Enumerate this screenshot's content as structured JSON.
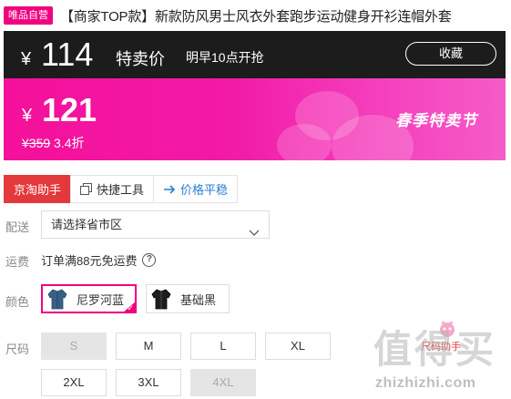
{
  "product": {
    "badge": "唯品自营",
    "title": "【商家TOP款】新款防风男士风衣外套跑步运动健身开衫连帽外套"
  },
  "price_banner": {
    "currency": "¥",
    "special_price": "114",
    "special_label": "特卖价",
    "start_time": "明早10点开抢",
    "favorite_label": "收藏",
    "current_price": "121",
    "original_price": "¥359",
    "discount": "3.4折",
    "promo": "春季特卖节",
    "colors": {
      "dark": "#1c1c1c",
      "pink": "#f4109a"
    }
  },
  "tools": {
    "tabs": [
      {
        "label": "京淘助手",
        "icon": ""
      },
      {
        "label": "快捷工具",
        "icon": "copy-icon"
      },
      {
        "label": "价格平稳",
        "icon": "arrow-right-icon"
      }
    ],
    "active_color": "#e4393c"
  },
  "delivery": {
    "label": "配送",
    "select_value": "请选择省市区"
  },
  "freight": {
    "label": "运费",
    "text": "订单满88元免运费",
    "help_icon": "question-circle-icon"
  },
  "color": {
    "label": "颜色",
    "options": [
      {
        "name": "尼罗河蓝",
        "selected": true,
        "swatch": "#3a5f88"
      },
      {
        "name": "基础黑",
        "selected": false,
        "swatch": "#1e1e1e"
      }
    ]
  },
  "size": {
    "label": "尺码",
    "options": [
      {
        "name": "S",
        "available": false
      },
      {
        "name": "M",
        "available": true
      },
      {
        "name": "L",
        "available": true
      },
      {
        "name": "XL",
        "available": true
      },
      {
        "name": "2XL",
        "available": true
      },
      {
        "name": "3XL",
        "available": true
      },
      {
        "name": "4XL",
        "available": false
      }
    ],
    "helper": "尺码助手"
  },
  "watermark": {
    "logo": "值得买",
    "url": "zhizhizhi.com"
  }
}
